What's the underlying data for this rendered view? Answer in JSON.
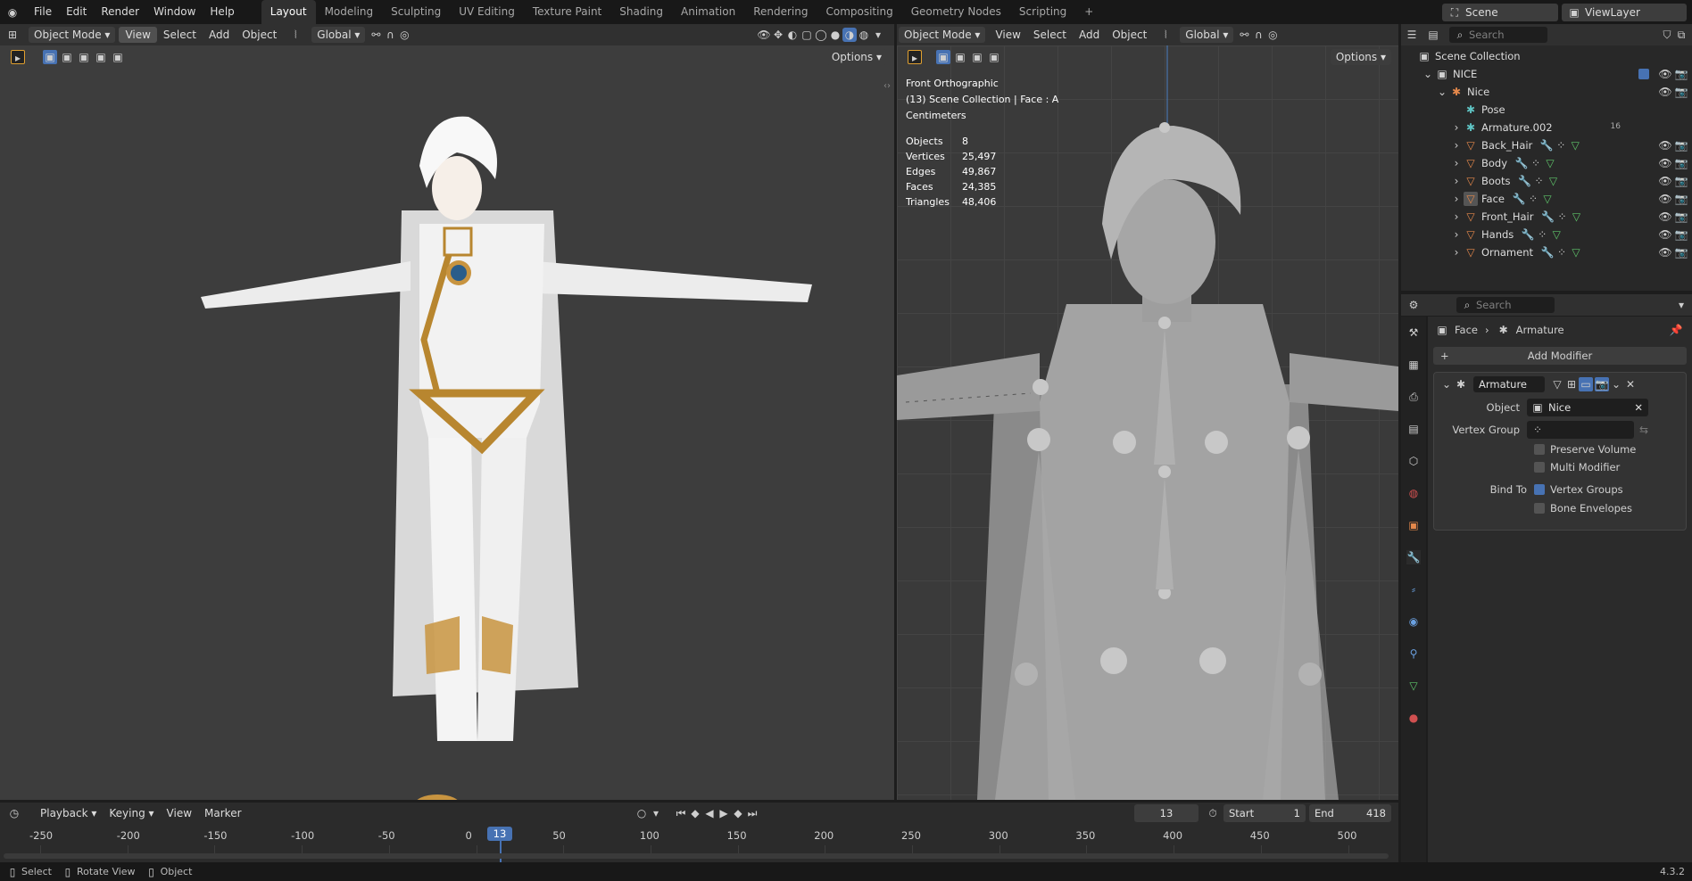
{
  "menus": [
    "File",
    "Edit",
    "Render",
    "Window",
    "Help"
  ],
  "workspaces": [
    "Layout",
    "Modeling",
    "Sculpting",
    "UV Editing",
    "Texture Paint",
    "Shading",
    "Animation",
    "Rendering",
    "Compositing",
    "Geometry Nodes",
    "Scripting"
  ],
  "active_workspace": "Layout",
  "scene_name": "Scene",
  "view_layer": "ViewLayer",
  "viewport_left": {
    "mode": "Object Mode",
    "menu": [
      "View",
      "Select",
      "Add",
      "Object"
    ],
    "orientation": "Global",
    "options": "Options"
  },
  "viewport_right": {
    "mode": "Object Mode",
    "menu": [
      "View",
      "Select",
      "Add",
      "Object"
    ],
    "orientation": "Global",
    "options": "Options",
    "view_name": "Front Orthographic",
    "context_line": "(13) Scene Collection | Face : A",
    "units": "Centimeters",
    "stats": [
      {
        "label": "Objects",
        "value": "8"
      },
      {
        "label": "Vertices",
        "value": "25,497"
      },
      {
        "label": "Edges",
        "value": "49,867"
      },
      {
        "label": "Faces",
        "value": "24,385"
      },
      {
        "label": "Triangles",
        "value": "48,406"
      }
    ]
  },
  "outliner": {
    "search_placeholder": "Search",
    "root": "Scene Collection",
    "collection": "NICE",
    "armature": "Nice",
    "pose": "Pose",
    "items": [
      "Armature.002",
      "Back_Hair",
      "Body",
      "Boots",
      "Face",
      "Front_Hair",
      "Hands",
      "Ornament"
    ],
    "badge_count": "16"
  },
  "properties": {
    "search_placeholder": "Search",
    "breadcrumb_object": "Face",
    "breadcrumb_modifier": "Armature",
    "add_modifier": "Add Modifier",
    "modifier_name": "Armature",
    "object_label": "Object",
    "object_value": "Nice",
    "vertex_group_label": "Vertex Group",
    "preserve_volume": "Preserve Volume",
    "multi_modifier": "Multi Modifier",
    "bind_to_label": "Bind To",
    "vertex_groups": "Vertex Groups",
    "bone_envelopes": "Bone Envelopes"
  },
  "timeline": {
    "menu": [
      "Playback",
      "Keying",
      "View",
      "Marker"
    ],
    "current_frame": "13",
    "start_label": "Start",
    "start": "1",
    "end_label": "End",
    "end": "418",
    "ticks": [
      "-250",
      "-200",
      "-150",
      "-100",
      "-50",
      "0",
      "50",
      "100",
      "150",
      "200",
      "250",
      "300",
      "350",
      "400",
      "450",
      "500"
    ]
  },
  "status": {
    "select": "Select",
    "rotate": "Rotate View",
    "object": "Object",
    "version": "4.3.2"
  },
  "colors": {
    "accent": "#4772b3",
    "frame_marker": "#4772b3",
    "armature_orange": "#e5884b",
    "mesh_green": "#5fc46a"
  }
}
